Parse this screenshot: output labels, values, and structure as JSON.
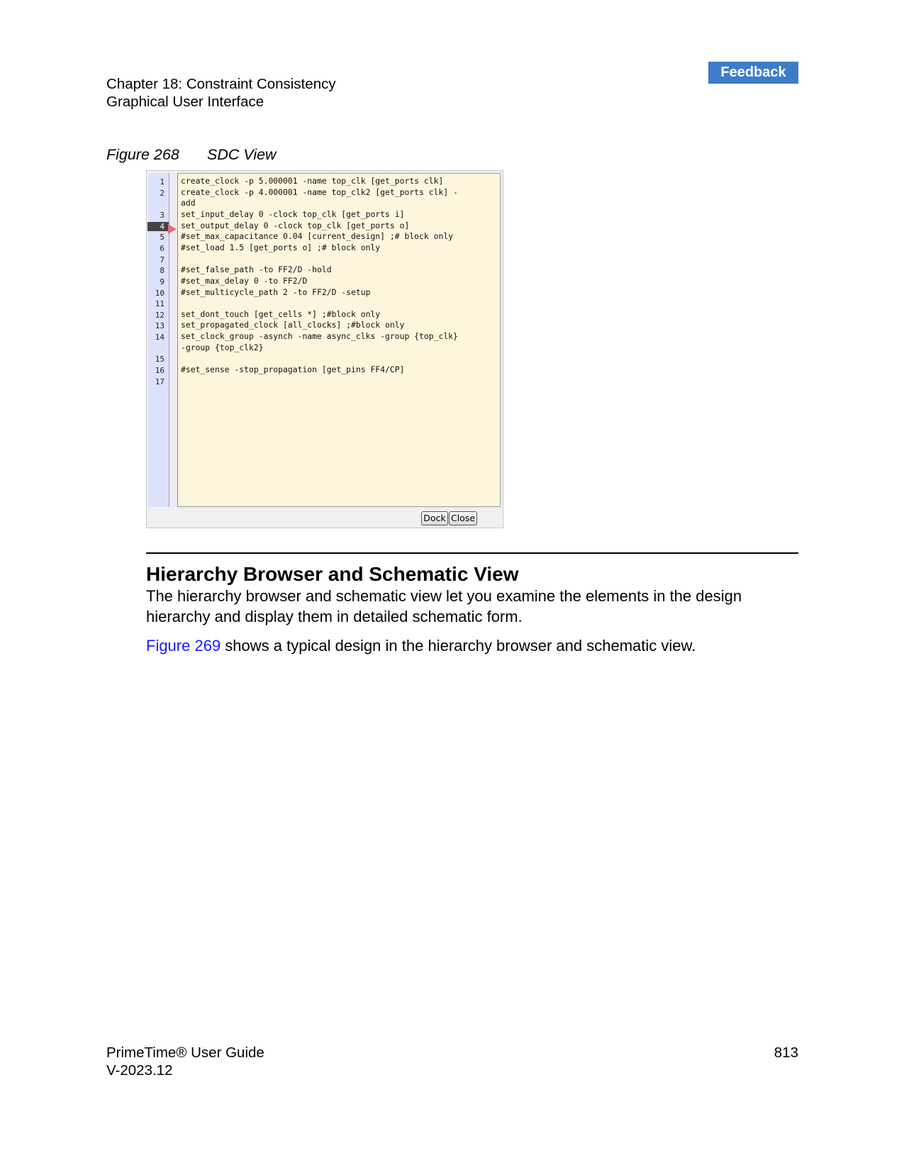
{
  "header": {
    "chapter": "Chapter 18: Constraint Consistency",
    "section": "Graphical User Interface",
    "feedback_label": "Feedback"
  },
  "figure": {
    "number": "Figure 268",
    "title": "SDC View"
  },
  "sdc_view": {
    "current_line": "4",
    "lines": [
      {
        "n": "1",
        "code": "create_clock -p 5.000001 -name top_clk [get_ports clk]"
      },
      {
        "n": "2",
        "code": "create_clock -p 4.000001 -name top_clk2 [get_ports clk] -"
      },
      {
        "n": "",
        "code": "add"
      },
      {
        "n": "3",
        "code": "set_input_delay 0 -clock top_clk [get_ports i]"
      },
      {
        "n": "4",
        "code": "set_output_delay 0 -clock top_clk [get_ports o]"
      },
      {
        "n": "5",
        "code": "#set_max_capacitance 0.04 [current_design] ;# block only"
      },
      {
        "n": "6",
        "code": "#set_load 1.5 [get_ports o] ;# block only"
      },
      {
        "n": "7",
        "code": ""
      },
      {
        "n": "8",
        "code": "#set_false_path -to FF2/D -hold"
      },
      {
        "n": "9",
        "code": "#set_max_delay 0 -to FF2/D"
      },
      {
        "n": "10",
        "code": "#set_multicycle_path 2 -to FF2/D -setup"
      },
      {
        "n": "11",
        "code": ""
      },
      {
        "n": "12",
        "code": "set_dont_touch [get_cells *] ;#block only"
      },
      {
        "n": "13",
        "code": "set_propagated_clock [all_clocks] ;#block only"
      },
      {
        "n": "14",
        "code": "set_clock_group -asynch -name async_clks -group {top_clk}"
      },
      {
        "n": "",
        "code": "-group {top_clk2}"
      },
      {
        "n": "15",
        "code": ""
      },
      {
        "n": "16",
        "code": "#set_sense -stop_propagation [get_pins FF4/CP]"
      },
      {
        "n": "17",
        "code": ""
      }
    ],
    "dock_label": "Dock",
    "close_label": "Close"
  },
  "section": {
    "heading": "Hierarchy Browser and Schematic View",
    "paragraph1": "The hierarchy browser and schematic view let you examine the elements in the design hierarchy and display them in detailed schematic form.",
    "link_text": "Figure 269",
    "paragraph2_rest": " shows a typical design in the hierarchy browser and schematic view."
  },
  "footer": {
    "product": "PrimeTime® User Guide",
    "version": "V-2023.12",
    "page_number": "813"
  }
}
